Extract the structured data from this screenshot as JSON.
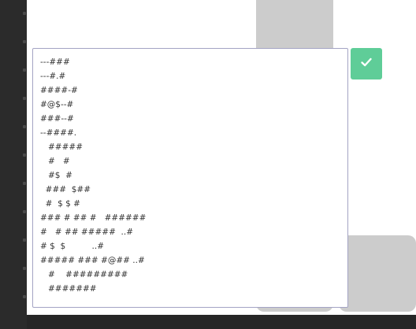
{
  "editor": {
    "value": "---###\n---#.#\n####-#\n#@$--#\n###--#\n--####.\n   #####\n   #   #\n   #$  #\n  ###  $##\n  #  $ $ #\n### # ## #   ######\n#   # ## #####  ..#\n# $  $          ..#\n##### ### #@## ..#\n   #    #########\n   #######",
    "confirm_icon": "checkmark-icon"
  },
  "colors": {
    "confirm_bg": "#5fcd98",
    "editor_border": "#a4a4c4",
    "tile": "#f6f6f6",
    "gray_block": "#cccccc"
  }
}
